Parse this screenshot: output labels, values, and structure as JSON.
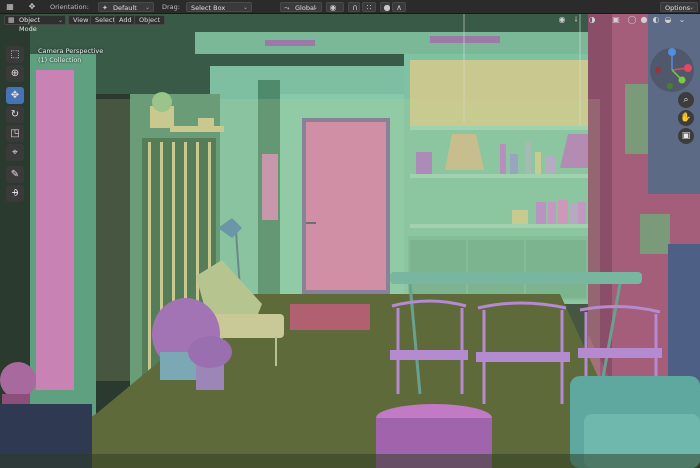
{
  "header": {
    "orientation_label": "Orientation:",
    "orientation_value": "Default",
    "drag_label": "Drag:",
    "drag_value": "Select Box",
    "transform_orientation": "Global",
    "options_label": "Options"
  },
  "mode_bar": {
    "mode": "Object Mode",
    "menus": [
      "View",
      "Select",
      "Add",
      "Object"
    ]
  },
  "viewport": {
    "camera_text": "Camera Perspective",
    "collection_text": "(1) Collection"
  },
  "icons": {
    "cursor_tool": "cursor-icon",
    "move_tool": "move-icon",
    "rotate_tool": "rotate-icon",
    "scale_tool": "scale-icon",
    "transform_tool": "transform-icon",
    "annotate_tool": "annotate-icon",
    "measure_tool": "measure-icon",
    "zoom": "zoom-icon",
    "pan": "hand-icon",
    "camera_view": "camera-icon"
  },
  "colors": {
    "accent": "#4772b3",
    "header_bg": "#2b2b2b",
    "wall_green": "#6fb090",
    "door_pink": "#d27fa8",
    "furniture_purple": "#a774b8",
    "floor_olive": "#5f6a3a"
  }
}
